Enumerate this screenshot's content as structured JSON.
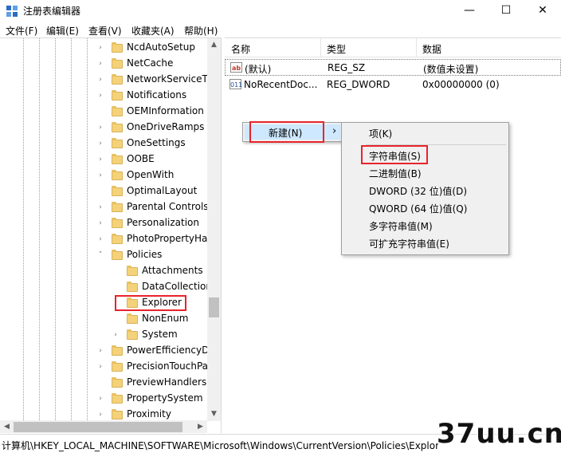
{
  "window": {
    "title": "注册表编辑器",
    "minimize_glyph": "—",
    "maximize_glyph": "☐",
    "close_glyph": "✕"
  },
  "menubar": [
    "文件(F)",
    "编辑(E)",
    "查看(V)",
    "收藏夹(A)",
    "帮助(H)"
  ],
  "tree": {
    "items": [
      {
        "label": "NcdAutoSetup",
        "chevron": "›"
      },
      {
        "label": "NetCache",
        "chevron": "›"
      },
      {
        "label": "NetworkServiceTr",
        "chevron": "›"
      },
      {
        "label": "Notifications",
        "chevron": "›"
      },
      {
        "label": "OEMInformation",
        "chevron": ""
      },
      {
        "label": "OneDriveRamps",
        "chevron": "›"
      },
      {
        "label": "OneSettings",
        "chevron": "›"
      },
      {
        "label": "OOBE",
        "chevron": "›"
      },
      {
        "label": "OpenWith",
        "chevron": "›"
      },
      {
        "label": "OptimalLayout",
        "chevron": ""
      },
      {
        "label": "Parental Controls",
        "chevron": "›"
      },
      {
        "label": "Personalization",
        "chevron": "›"
      },
      {
        "label": "PhotoPropertyHa",
        "chevron": "›"
      },
      {
        "label": "Policies",
        "chevron": "˅"
      },
      {
        "label": "Attachments",
        "chevron": ""
      },
      {
        "label": "DataCollection",
        "chevron": ""
      },
      {
        "label": "Explorer",
        "chevron": ""
      },
      {
        "label": "NonEnum",
        "chevron": ""
      },
      {
        "label": "System",
        "chevron": "›"
      },
      {
        "label": "PowerEfficiencyDi",
        "chevron": "›"
      },
      {
        "label": "PrecisionTouchPa",
        "chevron": "›"
      },
      {
        "label": "PreviewHandlers",
        "chevron": ""
      },
      {
        "label": "PropertySystem",
        "chevron": "›"
      },
      {
        "label": "Proximity",
        "chevron": "›"
      }
    ]
  },
  "list": {
    "columns": [
      "名称",
      "类型",
      "数据"
    ],
    "rows": [
      {
        "icon": "ab",
        "name": "(默认)",
        "type": "REG_SZ",
        "data": "(数值未设置)"
      },
      {
        "icon": "011",
        "name": "NoRecentDoc...",
        "type": "REG_DWORD",
        "data": "0x00000000 (0)"
      }
    ]
  },
  "context_menu": {
    "new_label": "新建(N)",
    "arrow": "›",
    "submenu": [
      "项(K)",
      "字符串值(S)",
      "二进制值(B)",
      "DWORD (32 位)值(D)",
      "QWORD (64 位)值(Q)",
      "多字符串值(M)",
      "可扩充字符串值(E)"
    ]
  },
  "statusbar": {
    "path": "计算机\\HKEY_LOCAL_MACHINE\\SOFTWARE\\Microsoft\\Windows\\CurrentVersion\\Policies\\Explorer"
  },
  "watermark": "37uu.cn",
  "colors": {
    "highlight_box": "#e8242b",
    "menu_hover": "#cde8ff",
    "folder": "#f4d27a"
  }
}
